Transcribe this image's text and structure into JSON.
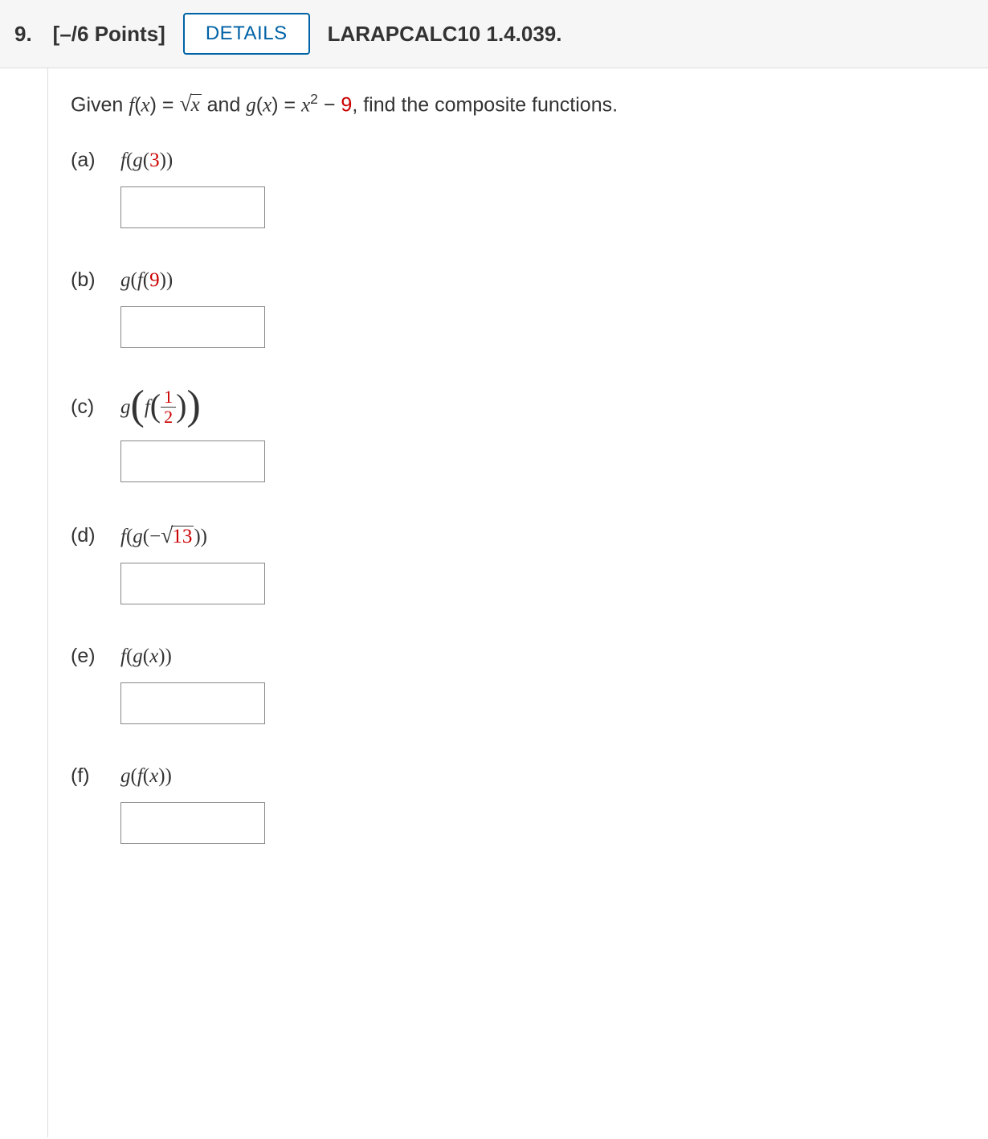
{
  "header": {
    "qnum_points": "9. [–/6 Points]",
    "details_label": "DETAILS",
    "source": "LARAPCALC10 1.4.039."
  },
  "prompt": {
    "given": "Given ",
    "f_eq": "f",
    "x_var": "x",
    "eq1": ") = ",
    "and": " and ",
    "g_eq": "g",
    "eq2": ") = ",
    "minus": " − ",
    "nine": "9",
    "tail": ", find the composite functions."
  },
  "parts": {
    "a": {
      "label": "(a)",
      "expr_f": "f",
      "expr_g": "g",
      "num": "3"
    },
    "b": {
      "label": "(b)",
      "expr_g": "g",
      "expr_f": "f",
      "num": "9"
    },
    "c": {
      "label": "(c)",
      "expr_g": "g",
      "expr_f": "f",
      "frac_num": "1",
      "frac_den": "2"
    },
    "d": {
      "label": "(d)",
      "expr_f": "f",
      "expr_g": "g",
      "neg": "−",
      "num": "13"
    },
    "e": {
      "label": "(e)",
      "expr_f": "f",
      "expr_g": "g",
      "xvar": "x"
    },
    "f": {
      "label": "(f)",
      "expr_g": "g",
      "expr_f": "f",
      "xvar": "x"
    }
  }
}
